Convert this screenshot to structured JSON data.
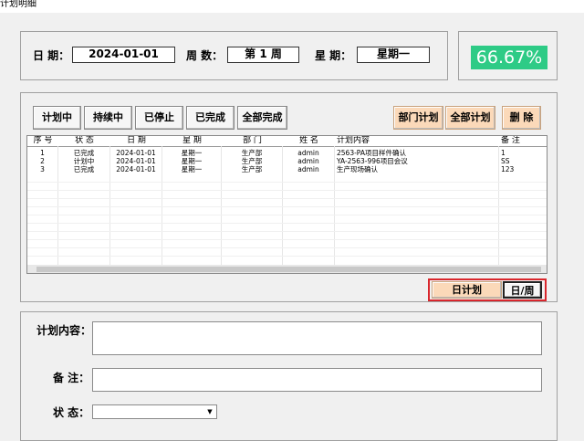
{
  "window": {
    "title": "计划明细"
  },
  "header": {
    "date_label": "日 期：",
    "date_value": "2024-01-01",
    "week_label": "周 数：",
    "week_value": "第 1 周",
    "weekday_label": "星 期：",
    "weekday_value": "星期一",
    "percent": "66.67%"
  },
  "filters": {
    "planning": "计划中",
    "ongoing": "持续中",
    "stopped": "已停止",
    "done": "已完成",
    "all_done": "全部完成",
    "dept_plan": "部门计划",
    "all_plan": "全部计划",
    "delete": "删 除"
  },
  "table": {
    "columns": [
      "序 号",
      "状 态",
      "日 期",
      "星 期",
      "部 门",
      "姓 名",
      "计划内容",
      "备 注"
    ],
    "rows": [
      [
        "1",
        "已完成",
        "2024-01-01",
        "星期一",
        "生产部",
        "admin",
        "2563-PA项目样件确认",
        "1"
      ],
      [
        "2",
        "计划中",
        "2024-01-01",
        "星期一",
        "生产部",
        "admin",
        "YA-2563-996项目会议",
        "SS"
      ],
      [
        "3",
        "已完成",
        "2024-01-01",
        "星期一",
        "生产部",
        "admin",
        "生产现场确认",
        "123"
      ]
    ]
  },
  "mode": {
    "day_plan": "日计划",
    "day_week": "日/周"
  },
  "form": {
    "content_label": "计划内容：",
    "note_label": "备 注：",
    "status_label": "状 态：",
    "status_value": ""
  },
  "colors": {
    "accent_green": "#2ecb86",
    "orange": "#fbd9b9",
    "highlight_red": "#d9262c"
  }
}
